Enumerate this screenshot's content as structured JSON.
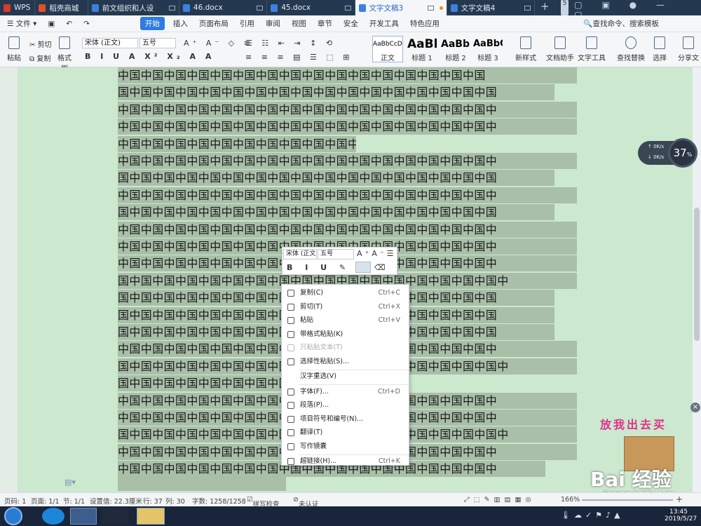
{
  "tabs": [
    {
      "label": "WPS",
      "w": 52,
      "color": "#d93a2b"
    },
    {
      "label": "稻壳商城",
      "w": 78,
      "color": "#e0502a"
    },
    {
      "label": "前文组织和人设",
      "w": 135,
      "color": "#3f7fe0"
    },
    {
      "label": "46.docx",
      "w": 130,
      "color": "#3f7fe0"
    },
    {
      "label": "45.docx",
      "w": 130,
      "color": "#3f7fe0"
    },
    {
      "label": "文字文稿3",
      "w": 136,
      "color": "#3f7fe0",
      "active": true
    },
    {
      "label": "文字文稿4",
      "w": 130,
      "color": "#3f7fe0"
    }
  ],
  "tabbar_extra": {
    "new_tab": "+",
    "count": "5"
  },
  "menu": {
    "file": "文件",
    "items": [
      "开始",
      "插入",
      "页面布局",
      "引用",
      "审阅",
      "视图",
      "章节",
      "安全",
      "开发工具",
      "特色应用"
    ],
    "search": "查找命令、搜索模板"
  },
  "ribbon": {
    "paste": "粘贴",
    "cut": "剪切",
    "copy": "复制",
    "format_painter": "格式刷",
    "font": "宋体 (正文)",
    "size": "五号",
    "styles": [
      {
        "preview": "AaBbCcDd",
        "name": "正文"
      },
      {
        "preview": "AaBb",
        "name": "标题 1"
      },
      {
        "preview": "AaBb(",
        "name": "标题 2"
      },
      {
        "preview": "AaBbC",
        "name": "标题 3"
      }
    ],
    "new_style": "新样式",
    "doc_helper": "文档助手",
    "text_tools": "文字工具",
    "find_replace": "查找替换",
    "select": "选择",
    "share": "分享文"
  },
  "document": {
    "lines": [
      {
        "t": "中国中国中国中国中国中国中国中国中国中国中国中国中国中国中国中国",
        "full": true
      },
      {
        "t": "国中国中国中国中国中国中国中国中国中国中国中国中国中国中国中国中国",
        "w": 623
      },
      {
        "t": "中国中国中国中国中国中国中国中国中国中国中国中国中国中国中国中国中",
        "full": true
      },
      {
        "t": "中国中国中国中国中国中国中国中国中国中国中国中国中国中国中国中国中",
        "full": true
      },
      {
        "t": "中国中国中国中国中国中国中国中国中国中国中国中国中国中国中国",
        "w": 340
      },
      {
        "t": "中国中国中国中国中国中国中国中国中国中国中国中国中国中国中国中国中",
        "full": true
      },
      {
        "t": "国中国中国中国中国中国中国中国中国中国中国中国中国中国中国中国中国",
        "w": 623
      },
      {
        "t": "中国中国中国中国中国中国中国中国中国中国中国中国中国中国中国中国中",
        "full": true
      },
      {
        "t": "国中国中国中国中国中国中国中国中国中国中国中国中国中国中国中国中国",
        "w": 623
      },
      {
        "t": "中国中国中国中国中国中国中国中国中国中国中国中国中国中国中国中国中",
        "full": true
      },
      {
        "t": "中国中国中国中国中国中国中国中国中国中国中国中国中国中国中国中国中",
        "full": true
      },
      {
        "t": "中国中国中国中国中国中国中国中国中国中国中国中国中国中国中国中国中",
        "full": true
      },
      {
        "t": "国中国中国中国中国中国中国中国中国中国中国中国中国中国中国中国中国中",
        "full": true
      },
      {
        "t": "国中国中国中国中国中国中国中国中国中国中国中国中国中国中国中国中国",
        "w": 623
      },
      {
        "t": "国中国中国中国中国中国中国中国中国中国中国中国中国中国中国中国中国",
        "w": 623
      },
      {
        "t": "国中国中国中国中国中国中国中国中国中国中国中国中国中国中国中国中国",
        "w": 623
      },
      {
        "t": "中国中国中国中国中国中国中国中国中国中国中国中国中国中国中国中国中",
        "full": true
      },
      {
        "t": "国中国中国中国中国中国中国中国中国中国中国中国中国中国中国中国中国中",
        "full": true
      },
      {
        "t": "国中国中国中国中国中国中国中国中国中国中国中国中国中国中国中国中国",
        "w": 400
      },
      {
        "t": "中国中国中国中国中国中国中国中国中国中国中国中国中国中国中国中国中",
        "full": true
      },
      {
        "t": "中国中国中国中国中国中国中国中国中国中国中国中国中国中国中国中国中",
        "full": true
      },
      {
        "t": "国中国中国中国中国中国中国中国中国中国中国中国中国中国中国中国中国中",
        "full": true
      },
      {
        "t": "中国中国中国中国中国中国中国中国中国中国中国中国中国中国中国中国中",
        "full": true
      },
      {
        "t": "中国中国中国中国中国中国中国中国中国中国中国中国中国中国中国中国中",
        "w": 610
      }
    ]
  },
  "net_widget": {
    "up": "0K/s",
    "down": "0K/s",
    "percent": "37",
    "unit": "%"
  },
  "mini_toolbar": {
    "font": "宋体 (正文",
    "size": "五号"
  },
  "context_menu": [
    {
      "label": "复制(C)",
      "shortcut": "Ctrl+C",
      "icon": "copy-icon"
    },
    {
      "label": "剪切(T)",
      "shortcut": "Ctrl+X",
      "icon": "scissors-icon"
    },
    {
      "label": "粘贴",
      "shortcut": "Ctrl+V",
      "icon": "paste-icon"
    },
    {
      "label": "带格式粘贴(K)",
      "shortcut": "",
      "icon": "paste-format-icon"
    },
    {
      "label": "只粘贴文本(T)",
      "shortcut": "",
      "icon": "paste-text-icon",
      "disabled": true
    },
    {
      "label": "选择性粘贴(S)...",
      "shortcut": "",
      "icon": "paste-special-icon",
      "sep_after": true
    },
    {
      "label": "汉字重选(V)",
      "shortcut": "",
      "icon": "",
      "sep_after": true
    },
    {
      "label": "字体(F)...",
      "shortcut": "Ctrl+D",
      "icon": "font-icon"
    },
    {
      "label": "段落(P)...",
      "shortcut": "",
      "icon": "paragraph-icon"
    },
    {
      "label": "项目符号和编号(N)...",
      "shortcut": "",
      "icon": "list-icon"
    },
    {
      "label": "翻译(T)",
      "shortcut": "",
      "icon": "translate-icon"
    },
    {
      "label": "写作镜囊",
      "shortcut": "",
      "icon": "writing-icon",
      "sep_after": true
    },
    {
      "label": "超链接(H)...",
      "shortcut": "Ctrl+K",
      "icon": "link-icon"
    }
  ],
  "sticker": "放我出去买",
  "watermark": {
    "logo": "Bai 经验",
    "url": "jingyan.baidu.com"
  },
  "status": {
    "page": "页码: 1",
    "pages": "页面: 1/1",
    "section": "节: 1/1",
    "setting": "设置值: 22.3厘米",
    "row": "行: 37",
    "col": "列: 30",
    "words": "字数: 1258/1258",
    "spell": "拼写检查",
    "cert": "未认证",
    "zoom": "166%"
  },
  "taskbar": {
    "time": "13:45",
    "date": "2019/5/27"
  }
}
